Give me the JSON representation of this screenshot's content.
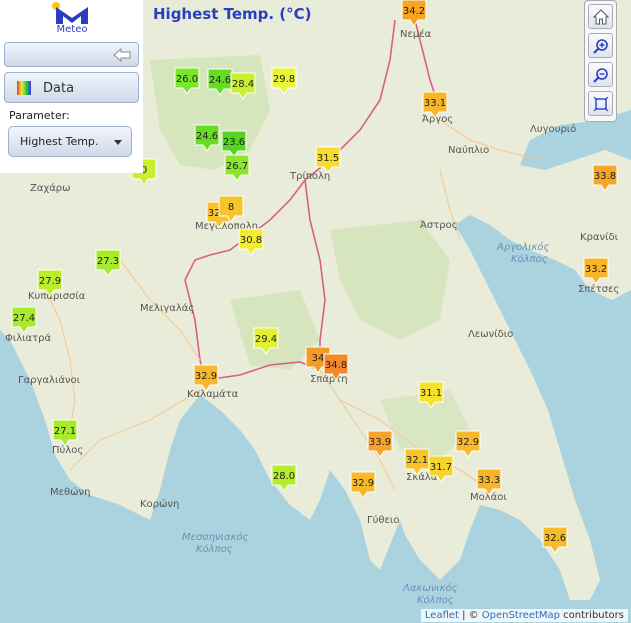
{
  "title": "Highest Temp. (°C)",
  "app": {
    "logo_text": "Meteo",
    "logo_icon": "meteo-m-logo",
    "brand_color": "#2a3fbf"
  },
  "panel": {
    "data_label": "Data",
    "parameter_label": "Parameter:",
    "parameter_value": "Highest Temp."
  },
  "toolbar": {
    "home_icon": "home-icon",
    "zoom_in_icon": "zoom-in-icon",
    "zoom_out_icon": "zoom-out-icon",
    "extent_icon": "full-extent-icon"
  },
  "attribution": {
    "leaflet": "Leaflet",
    "separator": " | © ",
    "osm": "OpenStreetMap",
    "suffix": " contributors"
  },
  "places": [
    {
      "name": "Νεμέα"
    },
    {
      "name": "Άργος"
    },
    {
      "name": "Ναύπλιο"
    },
    {
      "name": "Λυγουριό"
    },
    {
      "name": "Τρίπολη"
    },
    {
      "name": "Ζαχάρω"
    },
    {
      "name": "Μεγαλόπολη"
    },
    {
      "name": "Άστρος"
    },
    {
      "name": "Αργολικός Κόλπος"
    },
    {
      "name": "Κρανίδι"
    },
    {
      "name": "Σπέτσες"
    },
    {
      "name": "Κυπαρισσία"
    },
    {
      "name": "Μελιγαλάς"
    },
    {
      "name": "Φιλιατρά"
    },
    {
      "name": "Λεωνίδιο"
    },
    {
      "name": "Γαργαλιάνοι"
    },
    {
      "name": "Καλαμάτα"
    },
    {
      "name": "Σπάρτη"
    },
    {
      "name": "Πύλος"
    },
    {
      "name": "Σκάλα"
    },
    {
      "name": "Μολάοι"
    },
    {
      "name": "Μεθώνη"
    },
    {
      "name": "Κορώνη"
    },
    {
      "name": "Γύθειο"
    },
    {
      "name": "Μεσσηνιακός Κόλπος"
    },
    {
      "name": "Λακωνικός Κόλπος"
    }
  ],
  "stations": [
    {
      "value": "34.2",
      "color": "#f5a623"
    },
    {
      "value": "26.0",
      "color": "#7ae62a"
    },
    {
      "value": "24.6",
      "color": "#66dd22"
    },
    {
      "value": "28.4",
      "color": "#c9ef2e"
    },
    {
      "value": "29.8",
      "color": "#e9f535"
    },
    {
      "value": "33.1",
      "color": "#f7b52a"
    },
    {
      "value": "24.6",
      "color": "#66dd22"
    },
    {
      "value": "23.6",
      "color": "#55d522"
    },
    {
      "value": "26.7",
      "color": "#8be52b"
    },
    {
      "value": "31.5",
      "color": "#f7dc2b"
    },
    {
      "value": "33.8",
      "color": "#f7a62b"
    },
    {
      "value": "0",
      "color": "#c9ef2e"
    },
    {
      "value": "32.2",
      "color": "#f7c42b"
    },
    {
      "value": "8",
      "color": "#f7c42b"
    },
    {
      "value": "30.8",
      "color": "#f3ec31"
    },
    {
      "value": "27.3",
      "color": "#a8eb2c"
    },
    {
      "value": "27.9",
      "color": "#bced2d"
    },
    {
      "value": "33.2",
      "color": "#f7b52a"
    },
    {
      "value": "27.4",
      "color": "#a8eb2c"
    },
    {
      "value": "29.4",
      "color": "#e2f233"
    },
    {
      "value": "34",
      "color": "#f59a25"
    },
    {
      "value": "34.8",
      "color": "#f5892a"
    },
    {
      "value": "32.9",
      "color": "#f7b82a"
    },
    {
      "value": "31.1",
      "color": "#f7e22b"
    },
    {
      "value": "27.1",
      "color": "#a8eb2c"
    },
    {
      "value": "33.9",
      "color": "#f7a32b"
    },
    {
      "value": "32.9",
      "color": "#f7b82a"
    },
    {
      "value": "32.1",
      "color": "#f7c42b"
    },
    {
      "value": "31.7",
      "color": "#f7d42b"
    },
    {
      "value": "33.3",
      "color": "#f7b52a"
    },
    {
      "value": "28.0",
      "color": "#b6ec2d"
    },
    {
      "value": "32.9",
      "color": "#f7b82a"
    },
    {
      "value": "32.6",
      "color": "#f7bc2b"
    }
  ]
}
